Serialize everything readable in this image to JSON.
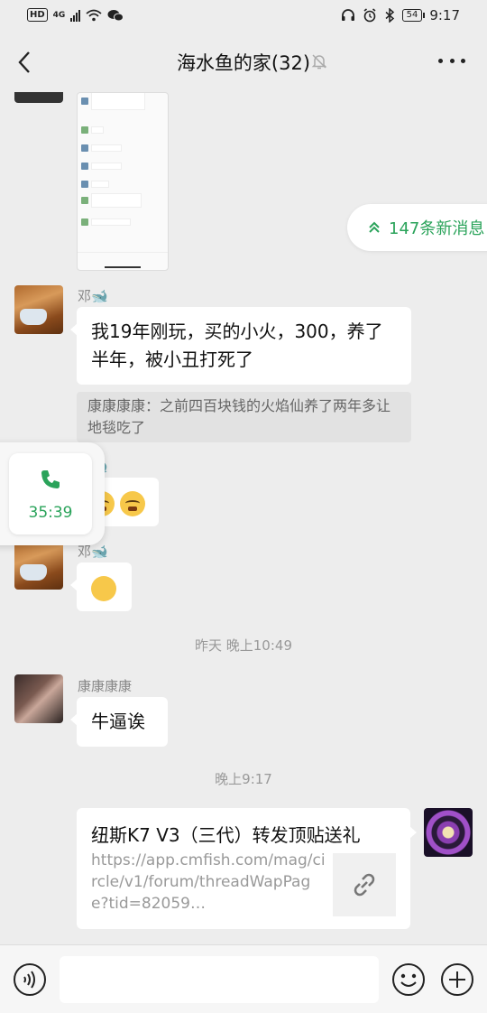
{
  "status_bar": {
    "left_badge": "HD",
    "network": "4G",
    "battery": "54",
    "time": "9:17"
  },
  "nav": {
    "title": "海水鱼的家(32)"
  },
  "new_messages": {
    "label": "147条新消息"
  },
  "call_float": {
    "duration": "35:39"
  },
  "messages": [
    {
      "sender": "邓",
      "text": "我19年刚玩，买的小火，300，养了半年，被小丑打死了",
      "quote": "康康康康：之前四百块钱的火焰仙养了两年多让地毯吃了"
    },
    {
      "sender": "邓"
    },
    {
      "sender": "邓"
    },
    {
      "timestamp": "昨天 晚上10:49"
    },
    {
      "sender": "康康康康",
      "text": "牛逼诶"
    },
    {
      "timestamp": "晚上9:17"
    },
    {
      "link_title": "纽斯K7 V3（三代）转发顶贴送礼",
      "link_url": "https://app.cmfish.com/mag/circle/v1/forum/threadWapPage?tid=82059…"
    }
  ],
  "colors": {
    "background": "#ededed",
    "accent_green": "#2aa35a",
    "bubble": "#ffffff"
  }
}
